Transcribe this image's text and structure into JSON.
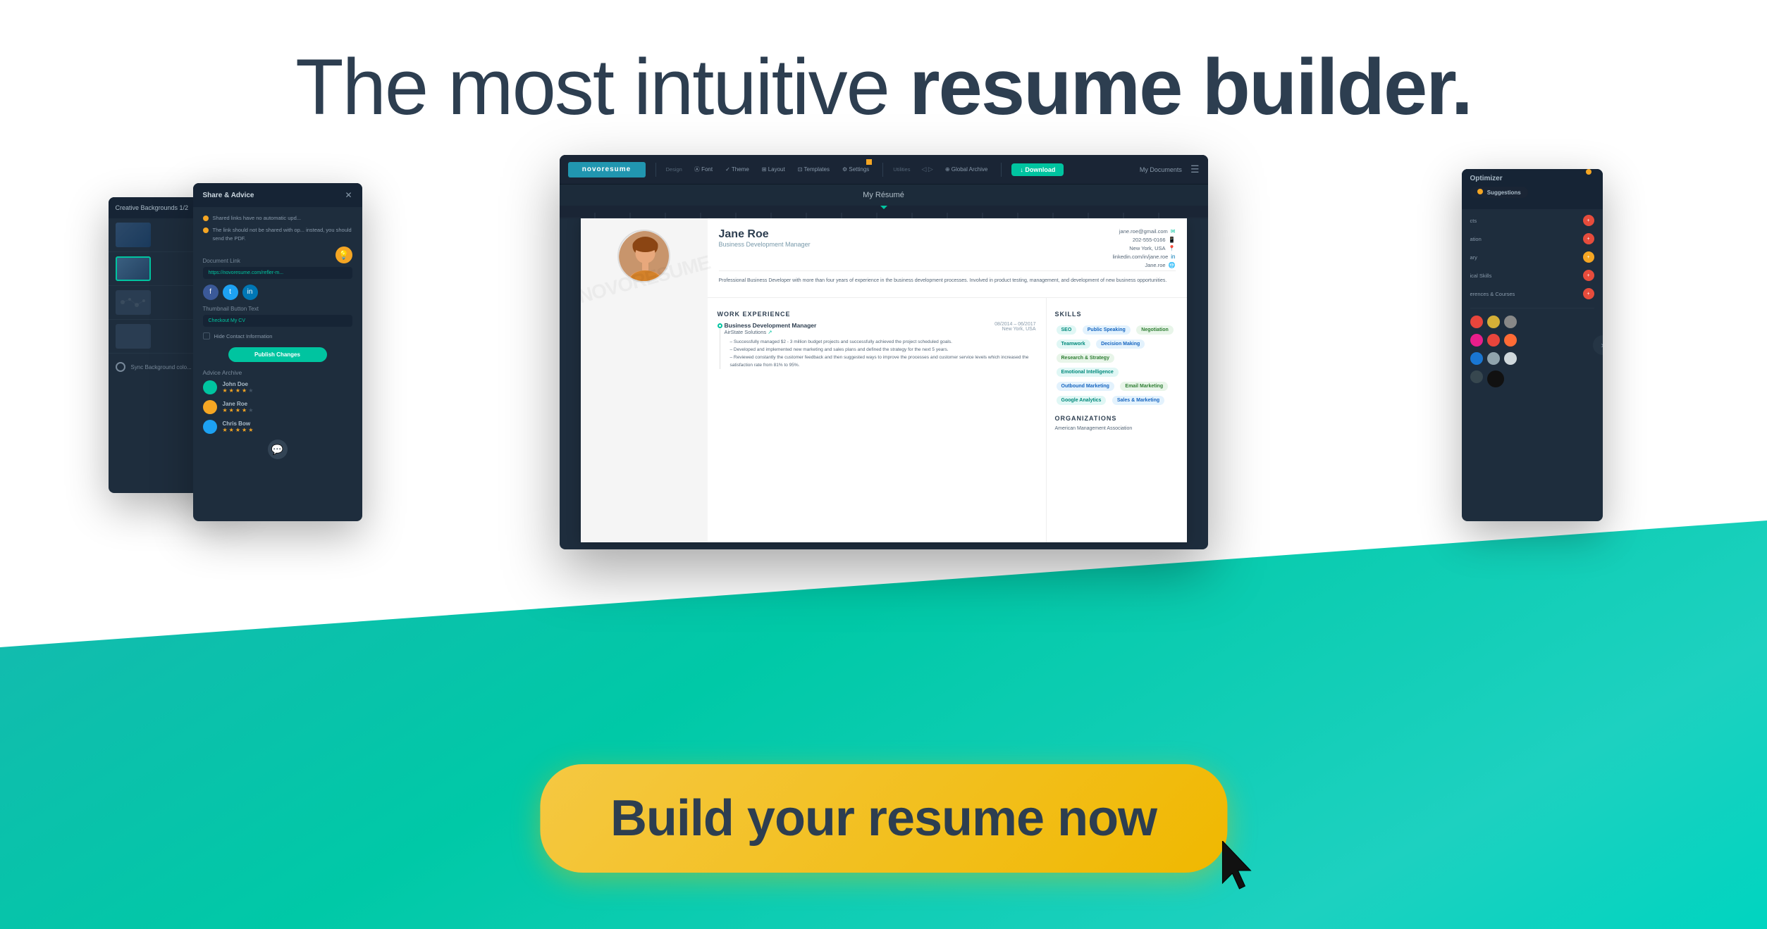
{
  "page": {
    "headline": {
      "part1": "The most intuitive ",
      "part2": "resume builder."
    },
    "cta": {
      "label": "Build your resume now"
    }
  },
  "resume": {
    "title": "My Résumé",
    "person": {
      "name": "Jane Roe",
      "title": "Business Development Manager",
      "email": "jane.roe@gmail.com",
      "phone": "202-555-0166",
      "location": "New York, USA",
      "linkedin": "linkedin.com/in/jane.roe",
      "website": "Jane.roe"
    },
    "summary": "Professional Business Developer with more than four years of experience in the business development processes. Involved in product testing, management, and development of new business opportunities.",
    "work_experience": {
      "section_title": "WORK EXPERIENCE",
      "jobs": [
        {
          "title": "Business Development Manager",
          "company": "AirState Solutions",
          "dates": "08/2014 – 06/2017",
          "location": "New York, USA",
          "bullets": [
            "Successfully managed $2 - 3 million budget projects and successfully achieved the project scheduled goals.",
            "Developed and implemented new marketing and sales plans and defined the strategy for the next 5 years.",
            "Reviewed constantly the customer feedback and then suggested ways to improve the processes and customer service levels which increased the satisfaction rate from 81% to 95%."
          ]
        }
      ]
    },
    "skills": {
      "section_title": "SKILLS",
      "tags": [
        {
          "label": "SEO",
          "type": "teal"
        },
        {
          "label": "Public Speaking",
          "type": "blue"
        },
        {
          "label": "Negotiation",
          "type": "green"
        },
        {
          "label": "Teamwork",
          "type": "teal"
        },
        {
          "label": "Decision Making",
          "type": "blue"
        },
        {
          "label": "Research & Strategy",
          "type": "green"
        },
        {
          "label": "Emotional Intelligence",
          "type": "teal"
        },
        {
          "label": "Outbound Marketing",
          "type": "blue"
        },
        {
          "label": "Email Marketing",
          "type": "green"
        },
        {
          "label": "Google Analytics",
          "type": "teal"
        },
        {
          "label": "Sales & Marketing",
          "type": "blue"
        }
      ]
    },
    "organizations": {
      "section_title": "ORGANIZATIONS",
      "items": [
        "American Management Association"
      ]
    }
  },
  "toolbar": {
    "logo": "novoresume",
    "sections": {
      "design_label": "Design",
      "items": [
        "Font",
        "Theme",
        "Layout",
        "Templates",
        "Settings"
      ],
      "utilities_label": "Utilities",
      "utility_items": [
        "Global Archive"
      ]
    },
    "download": "↓ Download",
    "my_documents": "My Documents"
  },
  "share_panel": {
    "title": "Share & Advice",
    "bullets": [
      "Shared links have no automatic upd...",
      "The link should not be shared with ap... instead, you should send the PDF.",
      ""
    ],
    "document_link_label": "Document Link",
    "link_url": "https://novoresume.com/refler-m...",
    "thumbnail_label": "Thumbnail Button Text",
    "thumbnail_value": "Checkout My CV",
    "hide_contact_label": "Hide Contact Information",
    "publish_btn": "Publish Changes",
    "advice_archive_title": "Advice Archive",
    "persons": [
      {
        "name": "John Doe",
        "stars": 4
      },
      {
        "name": "Jane Roe",
        "stars": 4
      },
      {
        "name": "Chris Bow",
        "stars": 5
      }
    ],
    "sync_label": "Sync Background colo..."
  },
  "bg_panel": {
    "title": "Creative Backgrounds 1/2",
    "items": [
      "bg1",
      "bg2",
      "bg3",
      "bg4"
    ]
  },
  "optimizer_panel": {
    "title": "Optimizer",
    "suggestions_label": "Suggestions",
    "rows": [
      {
        "label": "cts",
        "badge_type": "red"
      },
      {
        "label": "ation",
        "badge_type": "red"
      },
      {
        "label": "ary",
        "badge_type": "yellow"
      },
      {
        "label": "ical Skills",
        "badge_type": "red"
      },
      {
        "label": "erences & Courses",
        "badge_type": "red"
      }
    ],
    "color_palettes": [
      [
        "#e8453c",
        "#d4af37",
        "#888"
      ],
      [
        "#e91e8c",
        "#e8453c",
        "#ff6b35"
      ],
      [
        "#1976d2",
        "#778899",
        "#aabbcc"
      ],
      [
        "#556677",
        "#111",
        "#222"
      ]
    ]
  },
  "colors": {
    "teal_bg": "#17b8b0",
    "dark_navy": "#1e2d3d",
    "headline_color": "#2d3e50",
    "cta_yellow": "#f5c842",
    "cta_text_color": "#2d3e50",
    "skill_teal_bg": "#e0f7f5",
    "skill_teal_text": "#00897b",
    "skill_blue_bg": "#e3f2fd",
    "skill_blue_text": "#1565c0",
    "skill_green_bg": "#e8f5e9",
    "skill_green_text": "#2e7d32"
  }
}
